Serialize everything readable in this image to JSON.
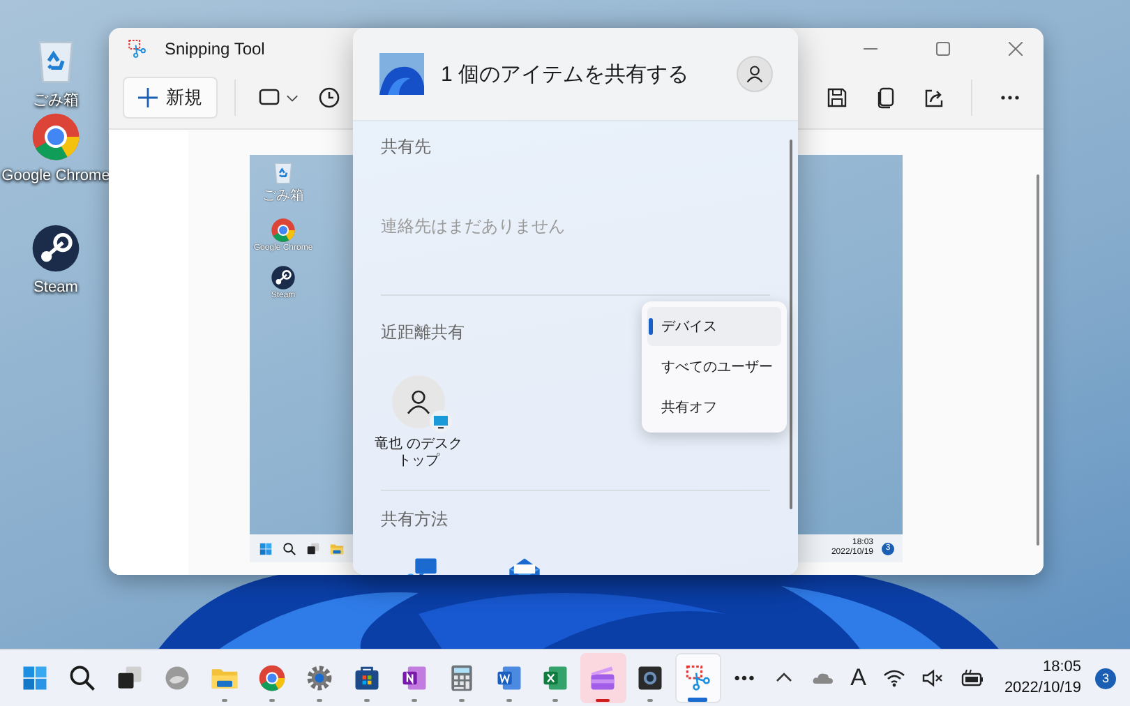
{
  "desktop_icons": [
    {
      "kind": "recycle-bin",
      "label": "ごみ箱"
    },
    {
      "kind": "chrome",
      "label": "Google Chrome"
    },
    {
      "kind": "steam",
      "label": "Steam"
    }
  ],
  "snipping_tool": {
    "title": "Snipping Tool",
    "new_button": "新規",
    "capture": {
      "desktop_icons": [
        {
          "kind": "recycle-bin",
          "label": "ごみ箱"
        },
        {
          "kind": "chrome",
          "label": "Google Chrome"
        },
        {
          "kind": "steam",
          "label": "Steam"
        }
      ],
      "time": "18:03",
      "date": "2022/10/19",
      "notification_count": "3"
    }
  },
  "share_panel": {
    "title": "1 個のアイテムを共有する",
    "contacts_heading": "共有先",
    "contacts_empty": "連絡先はまだありません",
    "nearby_heading": "近距離共有",
    "nearby_devices": [
      {
        "name": "竜也 のデスクトップ"
      }
    ],
    "share_via_heading": "共有方法",
    "share_apps": [
      {
        "kind": "chat"
      },
      {
        "kind": "mail"
      }
    ]
  },
  "nearby_menu": [
    {
      "label": "デバイス",
      "selected": true
    },
    {
      "label": "すべてのユーザー",
      "selected": false
    },
    {
      "label": "共有オフ",
      "selected": false
    }
  ],
  "taskbar": {
    "apps": [
      {
        "kind": "start",
        "running": false,
        "selected": false,
        "attention": false
      },
      {
        "kind": "search",
        "running": false,
        "selected": false,
        "attention": false
      },
      {
        "kind": "task-view",
        "running": false,
        "selected": false,
        "attention": false
      },
      {
        "kind": "edge",
        "running": false,
        "selected": false,
        "attention": false
      },
      {
        "kind": "explorer",
        "running": true,
        "selected": false,
        "attention": false
      },
      {
        "kind": "chrome",
        "running": true,
        "selected": false,
        "attention": false
      },
      {
        "kind": "settings",
        "running": true,
        "selected": false,
        "attention": false
      },
      {
        "kind": "store",
        "running": true,
        "selected": false,
        "attention": false
      },
      {
        "kind": "onenote",
        "running": true,
        "selected": false,
        "attention": false
      },
      {
        "kind": "calculator",
        "running": true,
        "selected": false,
        "attention": false
      },
      {
        "kind": "word",
        "running": true,
        "selected": false,
        "attention": false
      },
      {
        "kind": "excel",
        "running": true,
        "selected": false,
        "attention": false
      },
      {
        "kind": "clipchamp",
        "running": true,
        "selected": false,
        "attention": true
      },
      {
        "kind": "camera",
        "running": true,
        "selected": false,
        "attention": false
      },
      {
        "kind": "snipping",
        "running": true,
        "selected": true,
        "attention": false
      }
    ],
    "overflow_label": "•••",
    "ime_indicator": "A",
    "time": "18:05",
    "date": "2022/10/19",
    "notification_count": "3"
  }
}
